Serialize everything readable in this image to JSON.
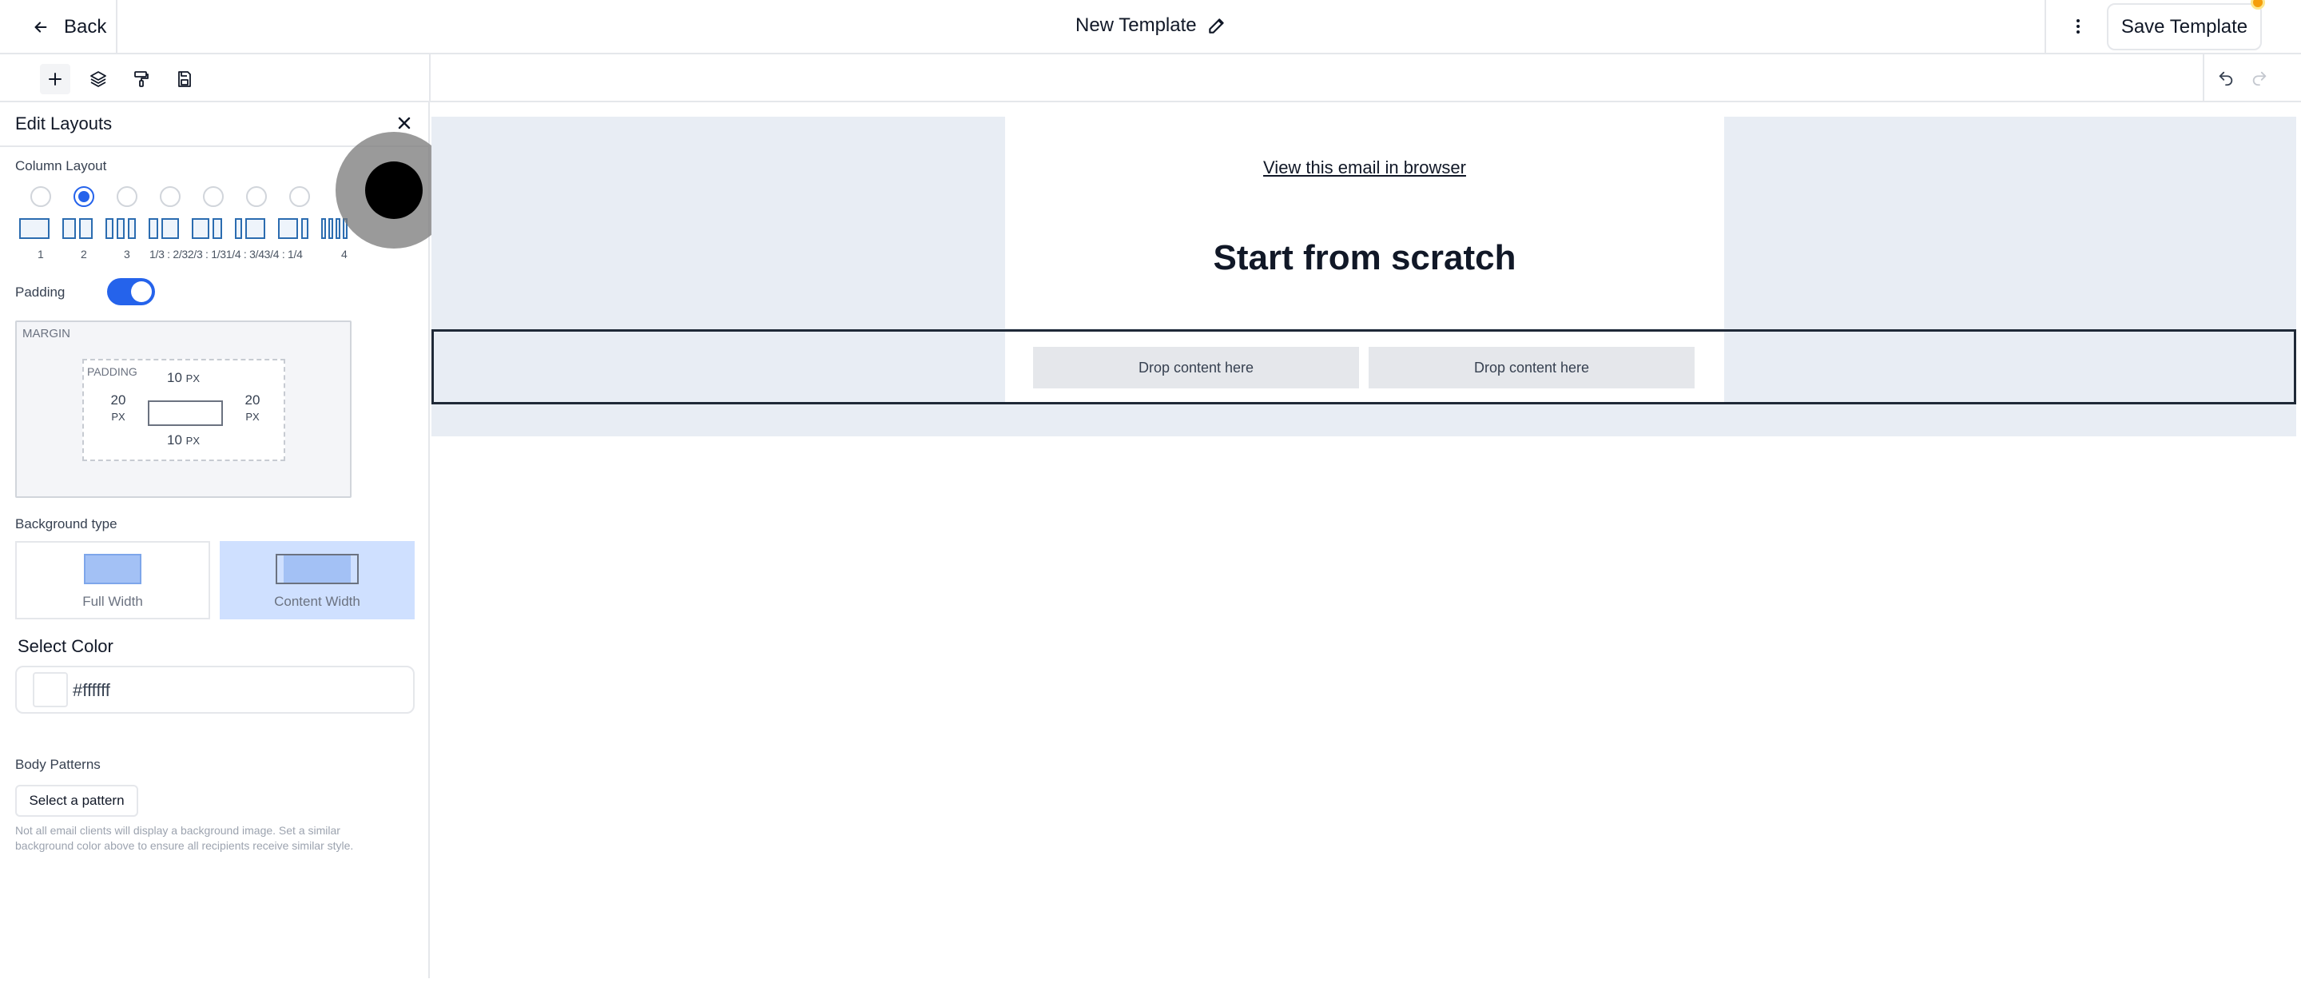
{
  "header": {
    "back_label": "Back",
    "title": "New Template",
    "save_label": "Save Template"
  },
  "toolbar": {
    "tools": [
      "add-icon",
      "layers-icon",
      "paint-roller-icon",
      "save-disk-icon"
    ],
    "undo": "undo-icon",
    "redo": "redo-icon"
  },
  "sidebar": {
    "title": "Edit Layouts",
    "column_layout_label": "Column Layout",
    "layouts": [
      {
        "label": "1",
        "selected": false
      },
      {
        "label": "2",
        "selected": true
      },
      {
        "label": "3",
        "selected": false
      },
      {
        "label": "1/3 : 2/3",
        "selected": false
      },
      {
        "label": "2/3 : 1/3",
        "selected": false
      },
      {
        "label": "1/4 : 3/4",
        "selected": false
      },
      {
        "label": "3/4 : 1/4",
        "selected": false
      },
      {
        "label": "4",
        "selected": false
      }
    ],
    "layout_numbers_text": "1/3 : 2/32/3 : 1/31/4 : 3/43/4 : 1/4",
    "padding_label": "Padding",
    "padding_enabled": true,
    "margin_label": "MARGIN",
    "padding_box_label": "PADDING",
    "padding_top": "10",
    "padding_bottom": "10",
    "padding_left": "20",
    "padding_right": "20",
    "unit": "PX",
    "background_type_label": "Background type",
    "background_options": [
      "Full Width",
      "Content Width"
    ],
    "background_selected": "Content Width",
    "select_color_label": "Select Color",
    "color_value": "#ffffff",
    "body_patterns_label": "Body Patterns",
    "select_pattern_label": "Select a pattern",
    "hint": "Not all email clients will display a background image. Set a similar background color above to ensure all recipients receive similar style."
  },
  "canvas": {
    "view_in_browser": "View this email in browser",
    "heading": "Start from scratch",
    "drop_left": "Drop content here",
    "drop_right": "Drop content here"
  },
  "colors": {
    "accent": "#2563eb",
    "canvas_bg": "#e8edf4",
    "notification": "#f59e0b"
  }
}
